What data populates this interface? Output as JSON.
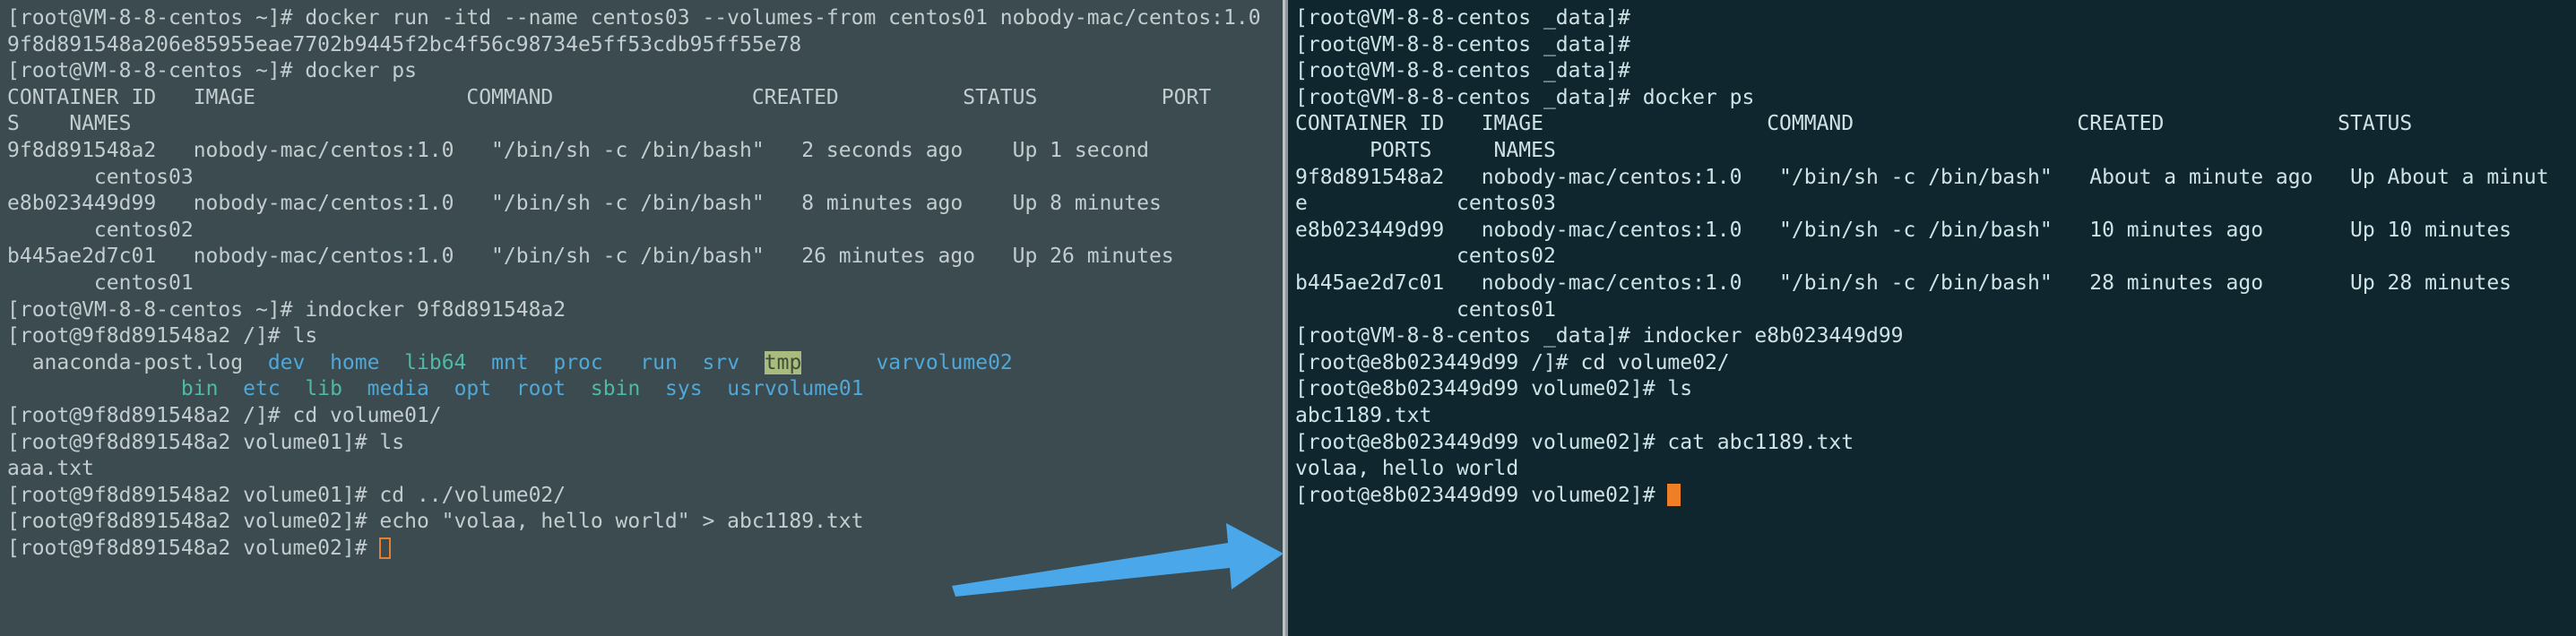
{
  "theme": {
    "left_bg": "#3b4b50",
    "right_bg": "#10262e",
    "left_fg": "#c3cdcf",
    "right_fg": "#cfe3e6",
    "divider": "#b9c2c4",
    "cursor_color": "#ef7f27",
    "dir_color": "#4fa8d8",
    "symlink_color": "#4fb9a5",
    "tmp_bg": "#a9bb7e",
    "arrow_color": "#4aa8ea"
  },
  "annotation": {
    "arrow": "right-arrow",
    "from": "host shell (left pane)",
    "to": "host shell (right pane)"
  },
  "left_pane": {
    "name": "host-terminal-centos03",
    "lines": [
      {
        "text": "[root@VM-8-8-centos ~]# docker run -itd --name centos03 --volumes-from centos01 nobody-mac/centos:1.0"
      },
      {
        "text": "9f8d891548a206e85955eae7702b9445f2bc4f56c98734e5ff53cdb95ff55e78"
      },
      {
        "text": "[root@VM-8-8-centos ~]# docker ps"
      },
      {
        "text": "CONTAINER ID   IMAGE                 COMMAND                CREATED          STATUS          PORT"
      },
      {
        "text": "S    NAMES"
      },
      {
        "text": "9f8d891548a2   nobody-mac/centos:1.0   \"/bin/sh -c /bin/bash\"   2 seconds ago    Up 1 second"
      },
      {
        "text": "       centos03"
      },
      {
        "text": "e8b023449d99   nobody-mac/centos:1.0   \"/bin/sh -c /bin/bash\"   8 minutes ago    Up 8 minutes"
      },
      {
        "text": "       centos02"
      },
      {
        "text": "b445ae2d7c01   nobody-mac/centos:1.0   \"/bin/sh -c /bin/bash\"   26 minutes ago   Up 26 minutes"
      },
      {
        "text": "       centos01"
      },
      {
        "text": "[root@VM-8-8-centos ~]# indocker 9f8d891548a2"
      },
      {
        "text": "[root@9f8d891548a2 /]# ls"
      },
      {
        "type": "ls_row_1"
      },
      {
        "type": "ls_row_2"
      },
      {
        "text": "[root@9f8d891548a2 /]# cd volume01/"
      },
      {
        "text": "[root@9f8d891548a2 volume01]# ls"
      },
      {
        "text": "aaa.txt"
      },
      {
        "text": "[root@9f8d891548a2 volume01]# cd ../volume02/"
      },
      {
        "text": "[root@9f8d891548a2 volume02]# echo \"volaa, hello world\" > abc1189.txt"
      },
      {
        "type": "prompt_cursor",
        "text": "[root@9f8d891548a2 volume02]# "
      }
    ],
    "ls_output": {
      "row1": [
        {
          "label": "anaconda-post.log",
          "kind": "plain",
          "pad": 2
        },
        {
          "label": "dev",
          "kind": "dir",
          "pad": 2
        },
        {
          "label": "home",
          "kind": "dir",
          "pad": 2
        },
        {
          "label": "lib64",
          "kind": "link",
          "pad": 2
        },
        {
          "label": "mnt",
          "kind": "dir",
          "pad": 2
        },
        {
          "label": "proc",
          "kind": "dir",
          "pad": 2
        },
        {
          "label": "run",
          "kind": "dir",
          "pad": 3
        },
        {
          "label": "srv",
          "kind": "dir",
          "pad": 2
        },
        {
          "label": "tmp",
          "kind": "tmp",
          "pad": 2
        },
        {
          "label": "var",
          "kind": "dir",
          "pad": 6
        },
        {
          "label": "volume02",
          "kind": "dir",
          "pad": 0
        }
      ],
      "row2": [
        {
          "label": "bin",
          "kind": "link",
          "pad": 14
        },
        {
          "label": "etc",
          "kind": "dir",
          "pad": 2
        },
        {
          "label": "lib",
          "kind": "link",
          "pad": 2
        },
        {
          "label": "media",
          "kind": "dir",
          "pad": 2
        },
        {
          "label": "opt",
          "kind": "dir",
          "pad": 2
        },
        {
          "label": "root",
          "kind": "dir",
          "pad": 2
        },
        {
          "label": "sbin",
          "kind": "link",
          "pad": 2
        },
        {
          "label": "sys",
          "kind": "dir",
          "pad": 2
        },
        {
          "label": "usr",
          "kind": "dir",
          "pad": 2
        },
        {
          "label": "volume01",
          "kind": "dir",
          "pad": 0
        }
      ]
    },
    "docker_ps": {
      "headers": [
        "CONTAINER ID",
        "IMAGE",
        "COMMAND",
        "CREATED",
        "STATUS",
        "PORTS",
        "NAMES"
      ],
      "rows": [
        {
          "container_id": "9f8d891548a2",
          "image": "nobody-mac/centos:1.0",
          "command": "\"/bin/sh -c /bin/bash\"",
          "created": "2 seconds ago",
          "status": "Up 1 second",
          "ports": "",
          "names": "centos03"
        },
        {
          "container_id": "e8b023449d99",
          "image": "nobody-mac/centos:1.0",
          "command": "\"/bin/sh -c /bin/bash\"",
          "created": "8 minutes ago",
          "status": "Up 8 minutes",
          "ports": "",
          "names": "centos02"
        },
        {
          "container_id": "b445ae2d7c01",
          "image": "nobody-mac/centos:1.0",
          "command": "\"/bin/sh -c /bin/bash\"",
          "created": "26 minutes ago",
          "status": "Up 26 minutes",
          "ports": "",
          "names": "centos01"
        }
      ]
    }
  },
  "right_pane": {
    "name": "host-terminal-data-dir",
    "lines": [
      {
        "text": "[root@VM-8-8-centos _data]#"
      },
      {
        "text": "[root@VM-8-8-centos _data]#"
      },
      {
        "text": "[root@VM-8-8-centos _data]#"
      },
      {
        "text": "[root@VM-8-8-centos _data]# docker ps"
      },
      {
        "text": "CONTAINER ID   IMAGE                  COMMAND                  CREATED              STATUS"
      },
      {
        "text": "      PORTS     NAMES"
      },
      {
        "text": "9f8d891548a2   nobody-mac/centos:1.0   \"/bin/sh -c /bin/bash\"   About a minute ago   Up About a minut"
      },
      {
        "text": "e            centos03"
      },
      {
        "text": "e8b023449d99   nobody-mac/centos:1.0   \"/bin/sh -c /bin/bash\"   10 minutes ago       Up 10 minutes"
      },
      {
        "text": "             centos02"
      },
      {
        "text": "b445ae2d7c01   nobody-mac/centos:1.0   \"/bin/sh -c /bin/bash\"   28 minutes ago       Up 28 minutes"
      },
      {
        "text": "             centos01"
      },
      {
        "text": "[root@VM-8-8-centos _data]# indocker e8b023449d99"
      },
      {
        "text": "[root@e8b023449d99 /]# cd volume02/"
      },
      {
        "text": "[root@e8b023449d99 volume02]# ls"
      },
      {
        "text": "abc1189.txt"
      },
      {
        "text": "[root@e8b023449d99 volume02]# cat abc1189.txt"
      },
      {
        "text": "volaa, hello world"
      },
      {
        "type": "prompt_cursor_solid",
        "text": "[root@e8b023449d99 volume02]# "
      }
    ],
    "docker_ps": {
      "headers": [
        "CONTAINER ID",
        "IMAGE",
        "COMMAND",
        "CREATED",
        "STATUS",
        "PORTS",
        "NAMES"
      ],
      "rows": [
        {
          "container_id": "9f8d891548a2",
          "image": "nobody-mac/centos:1.0",
          "command": "\"/bin/sh -c /bin/bash\"",
          "created": "About a minute ago",
          "status": "Up About a minute",
          "ports": "",
          "names": "centos03"
        },
        {
          "container_id": "e8b023449d99",
          "image": "nobody-mac/centos:1.0",
          "command": "\"/bin/sh -c /bin/bash\"",
          "created": "10 minutes ago",
          "status": "Up 10 minutes",
          "ports": "",
          "names": "centos02"
        },
        {
          "container_id": "b445ae2d7c01",
          "image": "nobody-mac/centos:1.0",
          "command": "\"/bin/sh -c /bin/bash\"",
          "created": "28 minutes ago",
          "status": "Up 28 minutes",
          "ports": "",
          "names": "centos01"
        }
      ]
    },
    "file_content": "volaa, hello world"
  }
}
